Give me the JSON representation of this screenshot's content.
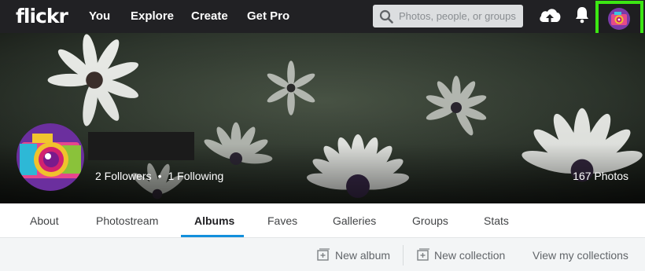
{
  "nav": {
    "logo": "flickr",
    "links": [
      "You",
      "Explore",
      "Create",
      "Get Pro"
    ],
    "search_placeholder": "Photos, people, or groups",
    "upload_icon": "cloud-upload-icon",
    "notifications_icon": "bell-icon"
  },
  "profile": {
    "followers": "2 Followers",
    "following": "1 Following",
    "separator": "•",
    "photo_count": "167 Photos"
  },
  "tabs": {
    "items": [
      "About",
      "Photostream",
      "Albums",
      "Faves",
      "Galleries",
      "Groups",
      "Stats"
    ],
    "active": "Albums"
  },
  "actions": {
    "new_album": "New album",
    "new_collection": "New collection",
    "view_collections": "View my collections"
  },
  "colors": {
    "nav_bg": "#212124",
    "highlight": "#3ce613",
    "tab_accent": "#128fdc"
  }
}
